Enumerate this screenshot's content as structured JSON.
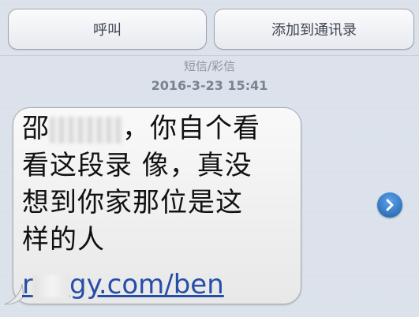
{
  "toolbar": {
    "call_label": "呼叫",
    "add_contact_label": "添加到通讯录"
  },
  "thread": {
    "message_type": "短信/彩信",
    "timestamp": "2016-3-23 15:41"
  },
  "message": {
    "line1_prefix": "邵",
    "line1_suffix": "，你自个看",
    "line2": "看这段录 像，真没",
    "line3": "想到你家那位是这",
    "line4": "样的人",
    "link_prefix": "r",
    "link_suffix": "gy.com/ben"
  },
  "icons": {
    "details": "chevron-right-icon"
  }
}
